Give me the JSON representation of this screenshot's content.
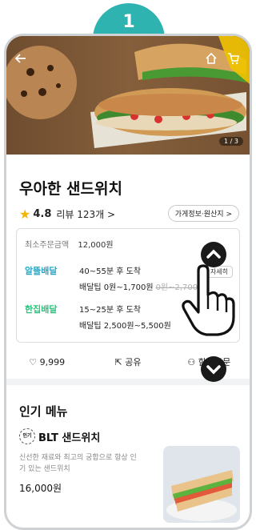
{
  "step_badge": "1",
  "header": {
    "back_icon": "back-arrow-icon",
    "home_icon": "home-icon",
    "cart_icon": "cart-icon",
    "image_counter": "1 / 3"
  },
  "store": {
    "name": "우아한 샌드위치",
    "rating": "4.8",
    "review_label": "리뷰 123개 >",
    "info_button": "가게정보·원산지 >"
  },
  "delivery": {
    "min_order_label": "최소주문금액",
    "min_order_value": "12,000원",
    "detail_button": "자세히",
    "options": [
      {
        "name": "알뜰배달",
        "time": "40~55분 후 도착",
        "tip_label": "배달팁 0원~1,700원",
        "tip_original": "0원~2,700원"
      },
      {
        "name": "한집배달",
        "time": "15~25분 후 도착",
        "tip_label": "배달팁 2,500원~5,500원",
        "tip_original": ""
      }
    ]
  },
  "actions": {
    "like_count": "9,999",
    "share_label": "공유",
    "together_label": "함께주문"
  },
  "popular": {
    "section_title": "인기 메뉴",
    "badge": "인기",
    "item_name": "BLT 샌드위치",
    "item_desc": "신선한 재료와 최고의 궁합으로 항상 인기 있는 샌드위치",
    "item_price": "16,000원"
  },
  "colors": {
    "badge": "#2fb3b1",
    "alddeul": "#2ba7c6",
    "hanjip": "#2ec27e",
    "star": "#f5b400"
  }
}
